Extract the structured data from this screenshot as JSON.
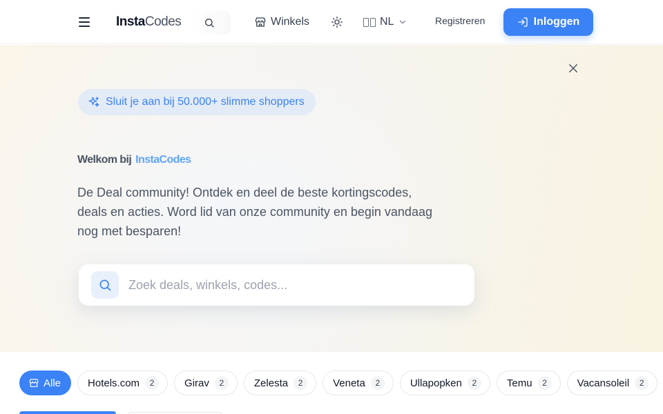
{
  "header": {
    "logo_bold": "Insta",
    "logo_light": "Codes",
    "winkels_label": "Winkels",
    "lang_label": "NL",
    "register_label": "Registreren",
    "login_label": "Inloggen"
  },
  "hero": {
    "badge": "Sluit je aan bij 50.000+ slimme shoppers",
    "welcome": "Welkom bij",
    "brand": "InstaCodes",
    "description": "De Deal community! Ontdek en deel de beste kortingscodes, deals en acties. Word lid van onze community en begin vandaag nog met besparen!",
    "search_placeholder": "Zoek deals, winkels, codes..."
  },
  "filters": [
    {
      "label": "Alle",
      "count": null,
      "active": true
    },
    {
      "label": "Hotels.com",
      "count": "2",
      "active": false
    },
    {
      "label": "Girav",
      "count": "2",
      "active": false
    },
    {
      "label": "Zelesta",
      "count": "2",
      "active": false
    },
    {
      "label": "Veneta",
      "count": "2",
      "active": false
    },
    {
      "label": "Ullapopken",
      "count": "2",
      "active": false
    },
    {
      "label": "Temu",
      "count": "2",
      "active": false
    },
    {
      "label": "Vacansoleil",
      "count": "2",
      "active": false
    }
  ],
  "colors": {
    "accent": "#3b82f6",
    "badge_bg": "#e3ebf6",
    "text": "#4b5563"
  }
}
